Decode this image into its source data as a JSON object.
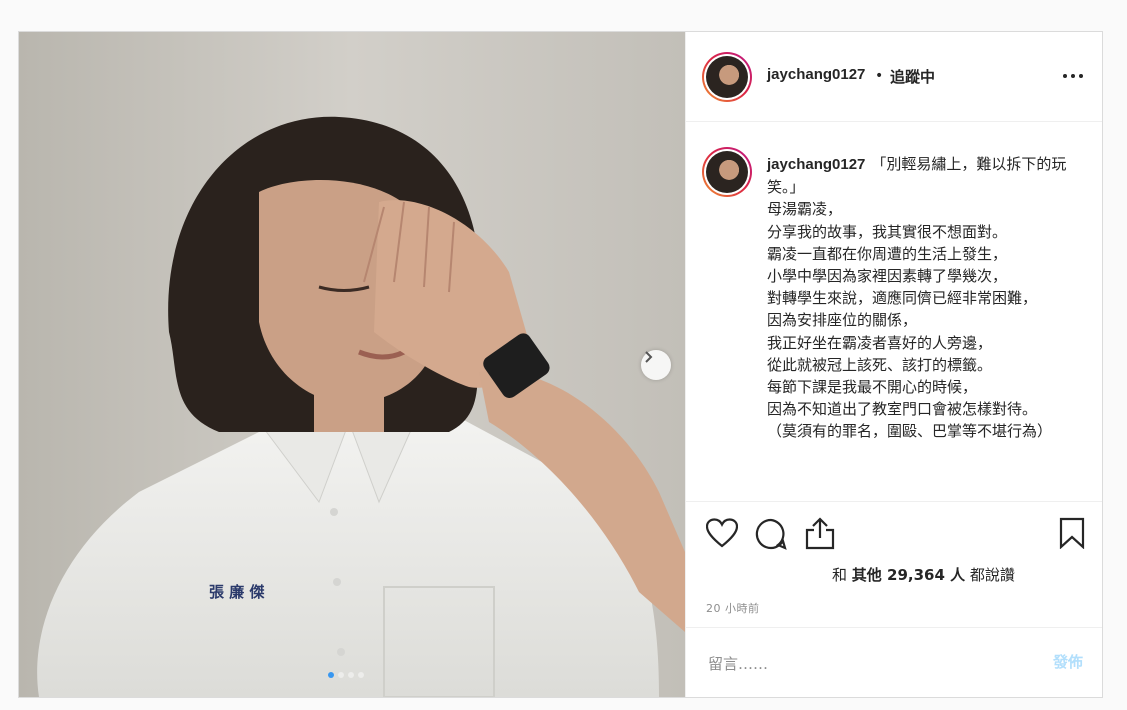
{
  "post": {
    "username": "jaychang0127",
    "separator": "•",
    "follow_status": "追蹤中",
    "caption_lines": "「別輕易繡上，難以拆下的玩笑。」\n母湯霸凌，\n分享我的故事，我其實很不想面對。\n霸凌一直都在你周遭的生活上發生，\n小學中學因為家裡因素轉了學幾次，\n對轉學生來說，適應同儕已經非常困難，\n因為安排座位的關係，\n我正好坐在霸凌者喜好的人旁邊，\n從此就被冠上該死、該打的標籤。\n每節下課是我最不開心的時候，\n因為不知道出了教室門口會被怎樣對待。\n（莫須有的罪名，圍毆、巴掌等不堪行為）",
    "shirt_name": "張 廉 傑",
    "likes_prefix": "和",
    "likes_text": "其他 29,364 人",
    "likes_suffix": "都說讚",
    "time_ago": "20 小時前",
    "carousel": {
      "count": 4,
      "active_index": 0
    }
  },
  "comment": {
    "placeholder": "留言……",
    "post_label": "發佈"
  },
  "icons": {
    "like": "heart-icon",
    "comment": "comment-bubble-icon",
    "share": "share-icon",
    "save": "bookmark-icon",
    "next": "chevron-right-icon",
    "more": "more-options-icon"
  },
  "colors": {
    "accent": "#3897f0",
    "post_disabled": "#b2dffc",
    "muted": "#8e8e8e"
  }
}
